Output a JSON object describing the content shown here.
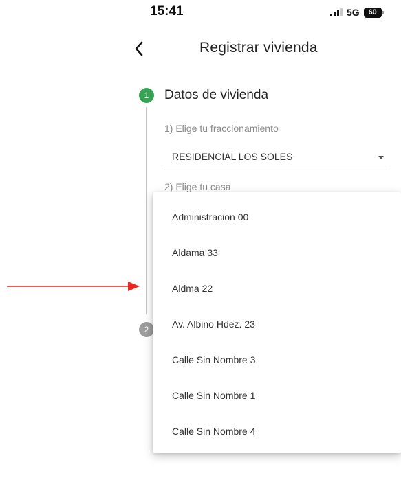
{
  "status_bar": {
    "time": "15:41",
    "network": "5G",
    "battery": "60"
  },
  "header": {
    "title": "Registrar vivienda",
    "back_icon": "chevron-left-icon"
  },
  "stepper": {
    "active_color": "#35a353",
    "inactive_color": "#9e9e9e",
    "steps": [
      {
        "number": "1",
        "title": "Datos de vivienda"
      },
      {
        "number": "2"
      }
    ]
  },
  "form": {
    "subdivision_label": "1) Elige tu fraccionamiento",
    "subdivision_value": "RESIDENCIAL LOS SOLES",
    "house_label": "2) Elige tu casa"
  },
  "dropdown": {
    "options": [
      "Administracion 00",
      "Aldama 33",
      "Aldma 22",
      "Av. Albino Hdez. 23",
      "Calle Sin Nombre 3",
      "Calle Sin Nombre 1",
      "Calle Sin Nombre 4"
    ]
  },
  "annotation": {
    "arrow_color": "#e8261f",
    "points_to_option": "Aldma 22"
  }
}
